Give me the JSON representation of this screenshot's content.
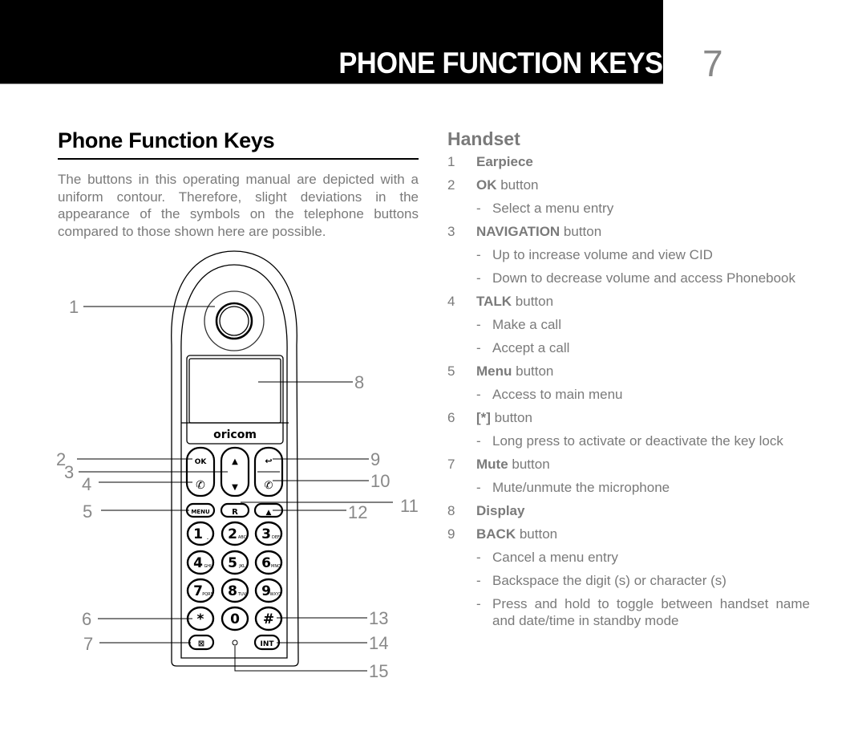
{
  "header": {
    "title": "PHONE FUNCTION KEYS",
    "page_number": "7"
  },
  "left": {
    "title": "Phone Function Keys",
    "intro": "The buttons in this operating manual are depicted with a uniform contour. Therefore, slight deviations in the appearance of the symbols on the telephone buttons compared to those shown here are possible."
  },
  "handset": {
    "title": "Handset",
    "items": [
      {
        "num": "1",
        "bold": "Earpiece",
        "rest": "",
        "subs": []
      },
      {
        "num": "2",
        "bold": "OK",
        "rest": " button",
        "subs": [
          "Select a menu entry"
        ]
      },
      {
        "num": "3",
        "bold": "NAVIGATION",
        "rest": " button",
        "subs": [
          "Up to increase volume and view CID",
          "Down to decrease volume and access Phonebook"
        ]
      },
      {
        "num": "4",
        "bold": "TALK",
        "rest": " button",
        "subs": [
          "Make a call",
          "Accept a call"
        ]
      },
      {
        "num": "5",
        "bold": "Menu",
        "rest": " button",
        "subs": [
          "Access to main menu"
        ]
      },
      {
        "num": "6",
        "bold": "[*]",
        "rest": " button",
        "subs": [
          "Long press to activate or deactivate the key lock"
        ]
      },
      {
        "num": "7",
        "bold": "Mute",
        "rest": " button",
        "subs": [
          "Mute/unmute the microphone"
        ]
      },
      {
        "num": "8",
        "bold": "Display",
        "rest": "",
        "subs": []
      },
      {
        "num": "9",
        "bold": "BACK",
        "rest": " button",
        "subs": [
          "Cancel a menu entry",
          "Backspace the digit (s) or character (s)",
          "Press and hold to toggle between handset name and date/time in standby mode"
        ]
      }
    ]
  },
  "diagram": {
    "brand": "oricom",
    "callouts": [
      "1",
      "2",
      "3",
      "4",
      "5",
      "6",
      "7",
      "8",
      "9",
      "10",
      "11",
      "12",
      "13",
      "14",
      "15"
    ],
    "keys": {
      "ok": "OK",
      "menu": "MENU",
      "r": "R",
      "int": "INT",
      "digits": [
        {
          "d": "1",
          "l": "⎵"
        },
        {
          "d": "2",
          "l": "ABC"
        },
        {
          "d": "3",
          "l": "DEF"
        },
        {
          "d": "4",
          "l": "GHI"
        },
        {
          "d": "5",
          "l": "JKL"
        },
        {
          "d": "6",
          "l": "MNO"
        },
        {
          "d": "7",
          "l": "PQRS"
        },
        {
          "d": "8",
          "l": "TUV"
        },
        {
          "d": "9",
          "l": "WXYZ"
        },
        {
          "d": "*",
          "l": ""
        },
        {
          "d": "0",
          "l": ""
        },
        {
          "d": "#",
          "l": ""
        }
      ]
    }
  }
}
